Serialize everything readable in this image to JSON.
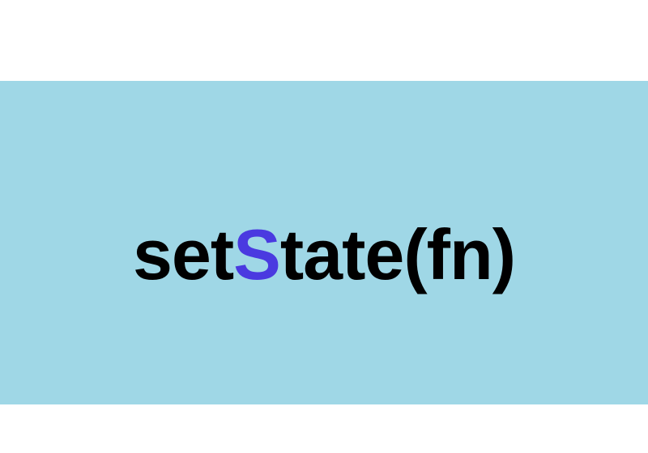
{
  "banner": {
    "title_prefix": "set",
    "title_accent": "S",
    "title_suffix": "tate(fn)"
  },
  "colors": {
    "banner_bg": "#9fd7e6",
    "accent": "#4a3ae0",
    "text": "#000000"
  }
}
